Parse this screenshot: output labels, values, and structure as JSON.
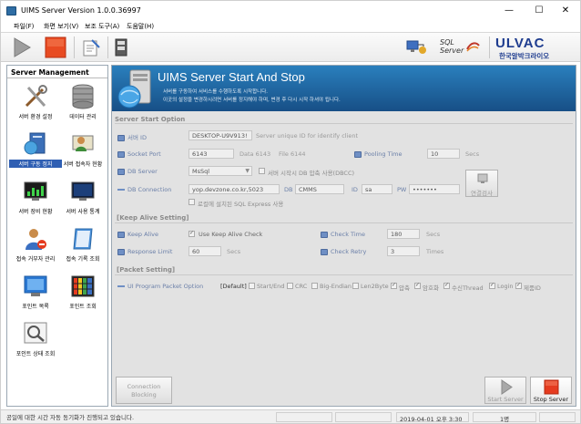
{
  "window": {
    "title": "UIMS Server Version 1.0.0.36997",
    "minimize": "—",
    "maximize": "☐",
    "close": "✕"
  },
  "menu": [
    "파일(F)",
    "화면 보기(V)",
    "보조 도구(A)",
    "도움말(H)"
  ],
  "toolbar": {
    "start_icon": "play-icon",
    "stop_icon": "stop-icon",
    "logo_sql": "SQL",
    "logo_server": "Server",
    "logo_ulvac": "ULVAC",
    "logo_ulvac_kr": "한국알박크라이오"
  },
  "sidebar": {
    "title": "Server Management",
    "items": [
      {
        "label": "서버 환경 설정",
        "icon": "tools-icon"
      },
      {
        "label": "데이터 관리",
        "icon": "database-icon"
      },
      {
        "label": "서버 구동 정지",
        "icon": "server-icon"
      },
      {
        "label": "서버 접속자 현황",
        "icon": "user-monitor-icon"
      },
      {
        "label": "서버 장비 현황",
        "icon": "monitor-graph-icon"
      },
      {
        "label": "서버 사용 통계",
        "icon": "monitor-icon"
      },
      {
        "label": "접속 거부자 관리",
        "icon": "user-block-icon"
      },
      {
        "label": "접속 기록 조회",
        "icon": "notepad-icon"
      },
      {
        "label": "포인트 목록",
        "icon": "point-list-icon"
      },
      {
        "label": "포인트 조회",
        "icon": "point-grid-icon"
      },
      {
        "label": "포인트 상태 조회",
        "icon": "magnifier-icon"
      }
    ]
  },
  "banner": {
    "title": "UIMS Server Start And Stop",
    "line1": "서버를 구동하여 서비스를 수행하도록 시작합니다.",
    "line2": "이곳의 설정을 변경하시려면 서버를 정지해야 하며, 변경 후 다시 시작 하셔야 됩니다."
  },
  "server_start": {
    "section": "Server Start Option",
    "server_id_label": "서버 ID",
    "server_id_value": "DESKTOP-U9V913!",
    "server_id_hint": "Server unique ID for identify client",
    "socket_port_label": "Socket Port",
    "socket_port_value": "6143",
    "data_port": "Data 6143",
    "file_port": "File 6144",
    "pooling_label": "Pooling Time",
    "pooling_value": "10",
    "pooling_unit": "Secs",
    "db_server_label": "DB Server",
    "db_server_value": "MsSql",
    "dbcc_label": "서버 시작시 DB 압축 사용(DBCC)",
    "db_conn_label": "DB Connection",
    "db_conn_value": "yop.devzone.co.kr,5023",
    "db_label": "DB",
    "db_value": "CMMS",
    "id_label": "ID",
    "id_value": "sa",
    "pw_label": "PW",
    "pw_value": "•••••••",
    "express_label": "로컬에 설치된 SQL Express 사용",
    "test_button": "연결검사"
  },
  "keep_alive": {
    "section": "[Keep Alive Setting]",
    "keep_alive_label": "Keep Alive",
    "use_label": "Use Keep Alive Check",
    "check_time_label": "Check Time",
    "check_time_value": "180",
    "check_time_unit": "Secs",
    "resp_limit_label": "Response Limit",
    "resp_limit_value": "60",
    "resp_limit_unit": "Secs",
    "check_retry_label": "Check Retry",
    "check_retry_value": "3",
    "check_retry_unit": "Times"
  },
  "packet": {
    "section": "[Packet Setting]",
    "ui_label": "UI Program Packet Option",
    "default_label": "[Default]",
    "options": [
      {
        "label": "Start/End",
        "checked": false
      },
      {
        "label": "CRC",
        "checked": false
      },
      {
        "label": "Big-Endian",
        "checked": false
      },
      {
        "label": "Len2Byte",
        "checked": false
      },
      {
        "label": "압축",
        "checked": true
      },
      {
        "label": "암호화",
        "checked": true
      },
      {
        "label": "수신Thread",
        "checked": true
      },
      {
        "label": "Login",
        "checked": true
      },
      {
        "label": "제품ID",
        "checked": true
      }
    ]
  },
  "bottom": {
    "connection_blocking": "Connection\nBlocking",
    "start_server": "Start Server",
    "stop_server": "Stop Server"
  },
  "statusbar": {
    "message": "공일에 대한 시간 자동 동기화가 진행되고 있습니다.",
    "datetime": "2019-04-01 오후 3:30",
    "count": "1명"
  },
  "colors": {
    "banner": "#1f6aa5",
    "stop_red": "#e53b1f",
    "selected": "#2f5fb3"
  }
}
